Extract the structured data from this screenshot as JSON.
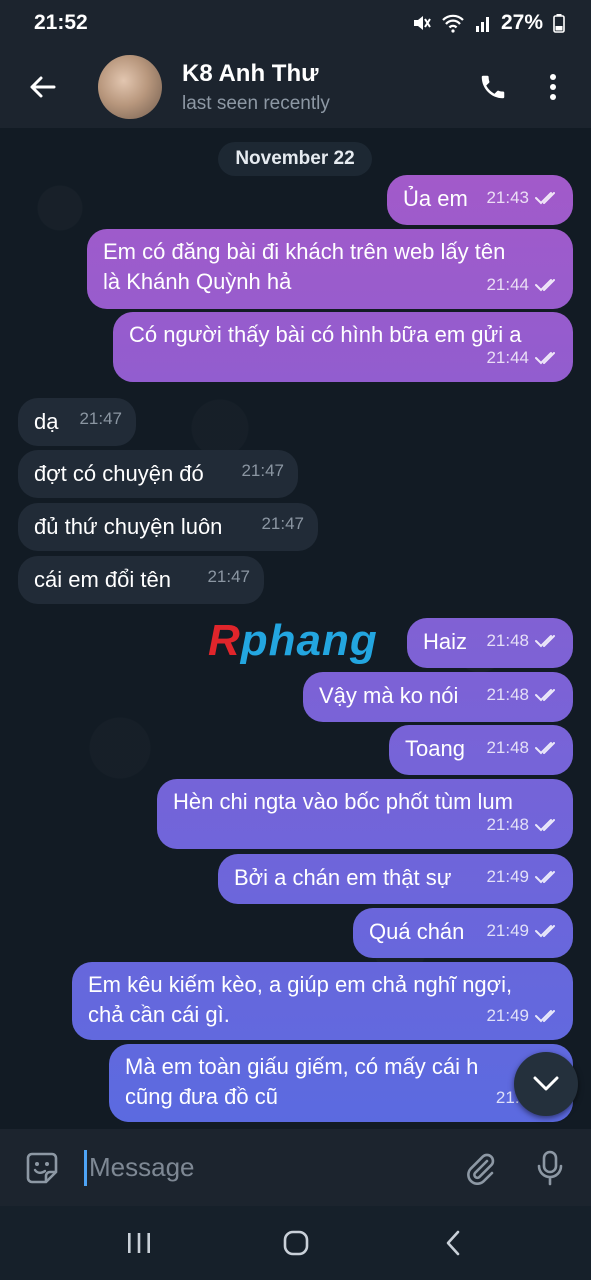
{
  "status_bar": {
    "time": "21:52",
    "battery": "27%"
  },
  "header": {
    "contact_name": "K8 Anh Thư",
    "contact_status": "last seen recently"
  },
  "chat": {
    "date_label": "November 22",
    "messages": [
      {
        "dir": "out",
        "lines": [
          "Ủa em"
        ],
        "time": "21:43",
        "read": true
      },
      {
        "dir": "out",
        "lines": [
          "Em có đăng bài đi khách trên web lấy tên",
          "là Khánh Quỳnh hả"
        ],
        "time": "21:44",
        "read": true
      },
      {
        "dir": "out",
        "lines": [
          "Có người thấy bài có hình bữa em gửi a"
        ],
        "time": "21:44",
        "read": true
      },
      {
        "dir": "in",
        "lines": [
          "dạ"
        ],
        "time": "21:47"
      },
      {
        "dir": "in",
        "lines": [
          "đợt có chuyện đó"
        ],
        "time": "21:47"
      },
      {
        "dir": "in",
        "lines": [
          "đủ thứ chuyện luôn"
        ],
        "time": "21:47"
      },
      {
        "dir": "in",
        "lines": [
          "cái em đổi tên"
        ],
        "time": "21:47"
      },
      {
        "dir": "out",
        "lines": [
          "Haiz"
        ],
        "time": "21:48",
        "read": true
      },
      {
        "dir": "out",
        "lines": [
          "Vậy mà ko nói"
        ],
        "time": "21:48",
        "read": true
      },
      {
        "dir": "out",
        "lines": [
          "Toang"
        ],
        "time": "21:48",
        "read": true
      },
      {
        "dir": "out",
        "lines": [
          "Hèn chi ngta vào bốc phốt tùm lum"
        ],
        "time": "21:48",
        "read": true
      },
      {
        "dir": "out",
        "lines": [
          "Bởi a chán em thật sự"
        ],
        "time": "21:49",
        "read": true
      },
      {
        "dir": "out",
        "lines": [
          "Quá chán"
        ],
        "time": "21:49",
        "read": true
      },
      {
        "dir": "out",
        "lines": [
          "Em kêu kiếm kèo, a giúp em chả nghĩ ngợi,",
          "chả cần cái gì."
        ],
        "time": "21:49",
        "read": true
      },
      {
        "dir": "out",
        "lines": [
          "Mà em toàn giấu giếm, có mấy cái h",
          "cũng đưa đồ cũ"
        ],
        "time": "21:5",
        "read": true
      }
    ]
  },
  "watermark": {
    "first": "R",
    "rest": "phang"
  },
  "composer": {
    "placeholder": "Message"
  },
  "icons": {
    "back": "arrow-left-icon",
    "call": "phone-icon",
    "menu": "kebab-menu-icon",
    "emoji": "sticker-emoji-icon",
    "attach": "paperclip-icon",
    "mic": "microphone-icon",
    "scroll": "chevron-down-icon",
    "read": "double-check-icon"
  },
  "colors": {
    "bubble_out_top": "#a559c9",
    "bubble_out_bottom": "#5b6ae0",
    "bubble_in": "#212b37",
    "accent": "#4ea4f6"
  }
}
